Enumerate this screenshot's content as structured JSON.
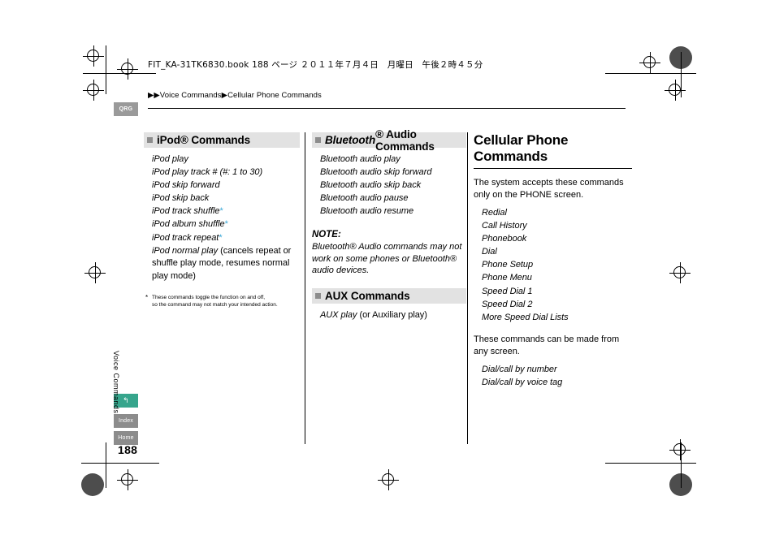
{
  "header": {
    "japanese_line": "FIT_KA-31TK6830.book  188 ページ  ２０１１年７月４日　月曜日　午後２時４５分",
    "breadcrumb": "▶▶Voice Commands▶Cellular Phone Commands"
  },
  "tabs": {
    "qrg": "QRG",
    "green": "↰",
    "index": "Index",
    "home": "Home"
  },
  "sidebar": {
    "vertical_label": "Voice Commands",
    "page_number": "188"
  },
  "columns": {
    "ipod": {
      "heading": "iPod® Commands",
      "items": [
        {
          "text": "iPod play"
        },
        {
          "text": "iPod play track # (#: 1 to 30)"
        },
        {
          "text": "iPod skip forward"
        },
        {
          "text": "iPod skip back"
        },
        {
          "text": "iPod track shuffle",
          "star": true
        },
        {
          "text": "iPod album shuffle",
          "star": true
        },
        {
          "text": "iPod track repeat",
          "star": true
        },
        {
          "text": "iPod normal play",
          "trailing": " (cancels repeat or shuffle play mode, resumes normal play mode)"
        }
      ],
      "footnote_mark": "*",
      "footnote_line1": "These commands toggle the function on and off,",
      "footnote_line2": "so the command may not match your intended action."
    },
    "bluetooth": {
      "heading_italic": "Bluetooth",
      "heading_rest": "® Audio Commands",
      "items": [
        {
          "text": "Bluetooth audio play"
        },
        {
          "text": "Bluetooth audio skip forward"
        },
        {
          "text": "Bluetooth audio skip back"
        },
        {
          "text": "Bluetooth audio pause"
        },
        {
          "text": "Bluetooth audio resume"
        }
      ],
      "note_title": "NOTE:",
      "note_body_italic": "Bluetooth",
      "note_body_rest": "® Audio commands may not work on some phones or Bluetooth® audio devices."
    },
    "aux": {
      "heading": "AUX Commands",
      "items": [
        {
          "text": "AUX play",
          "trailing": " (or Auxiliary play)"
        }
      ]
    },
    "cellular": {
      "title": "Cellular Phone Commands",
      "intro": "The system accepts these commands only on the PHONE screen.",
      "items": [
        {
          "text": "Redial"
        },
        {
          "text": "Call History"
        },
        {
          "text": "Phonebook"
        },
        {
          "text": "Dial"
        },
        {
          "text": "Phone Setup"
        },
        {
          "text": "Phone Menu"
        },
        {
          "text": "Speed Dial 1"
        },
        {
          "text": "Speed Dial 2"
        },
        {
          "text": "More Speed Dial Lists"
        }
      ],
      "second_para": "These commands can be made from any screen.",
      "items2": [
        {
          "text": "Dial/call by number"
        },
        {
          "text": "Dial/call by voice tag"
        }
      ]
    }
  }
}
